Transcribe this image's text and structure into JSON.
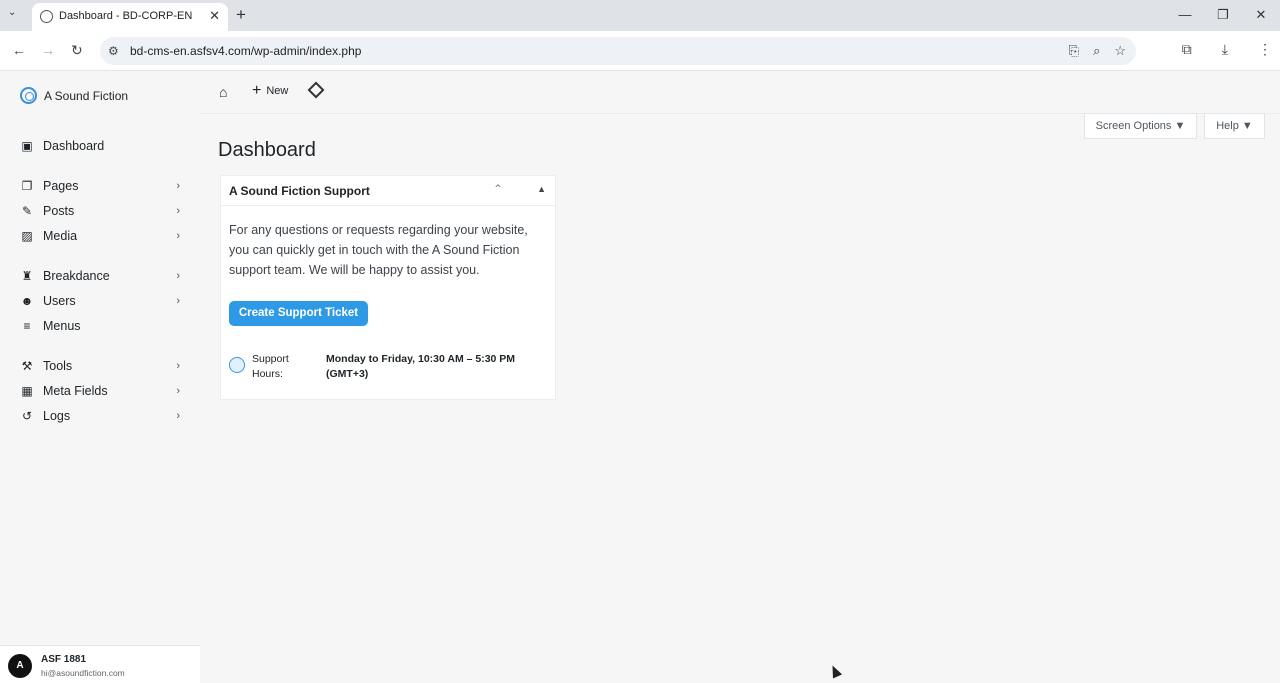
{
  "browser": {
    "tab_title": "Dashboard - BD-CORP-EN",
    "url": "bd-cms-en.asfsv4.com/wp-admin/index.php"
  },
  "brand": {
    "name": "A Sound Fiction"
  },
  "sidebar": {
    "items": [
      {
        "label": "Dashboard",
        "icon": "dashboard-icon",
        "has_submenu": false
      },
      {
        "label": "Pages",
        "icon": "pages-icon",
        "has_submenu": true
      },
      {
        "label": "Posts",
        "icon": "posts-icon",
        "has_submenu": true
      },
      {
        "label": "Media",
        "icon": "media-icon",
        "has_submenu": true
      },
      {
        "label": "Breakdance",
        "icon": "breakdance-icon",
        "has_submenu": true
      },
      {
        "label": "Users",
        "icon": "users-icon",
        "has_submenu": true
      },
      {
        "label": "Menus",
        "icon": "menus-icon",
        "has_submenu": false
      },
      {
        "label": "Tools",
        "icon": "tools-icon",
        "has_submenu": true
      },
      {
        "label": "Meta Fields",
        "icon": "meta-fields-icon",
        "has_submenu": true
      },
      {
        "label": "Logs",
        "icon": "logs-icon",
        "has_submenu": true
      }
    ]
  },
  "user": {
    "initial": "A",
    "name": "ASF 1881",
    "email": "hi@asoundfiction.com"
  },
  "topbar": {
    "new_label": "New"
  },
  "screen_options": {
    "label": "Screen Options ▼"
  },
  "help": {
    "label": "Help ▼"
  },
  "page": {
    "title": "Dashboard"
  },
  "widget": {
    "title": "A Sound Fiction Support",
    "body": "For any questions or requests regarding your website, you can quickly get in touch with the A Sound Fiction support team. We will be happy to assist you.",
    "button_label": "Create Support Ticket",
    "hours_label": "Support Hours:",
    "hours_value": "Monday to Friday, 10:30 AM – 5:30 PM (GMT+3)"
  },
  "colors": {
    "accent": "#2e9ae6",
    "brand": "#3a8fd8"
  }
}
